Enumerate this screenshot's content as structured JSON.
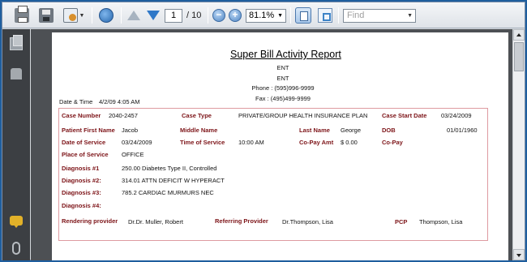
{
  "toolbar": {
    "page_current": "1",
    "page_total": "/ 10",
    "zoom": "81.1%",
    "find_placeholder": "Find",
    "icons": [
      "printer-icon",
      "save-icon",
      "export-icon",
      "globe-icon",
      "prev-page-icon",
      "next-page-icon",
      "zoom-out-icon",
      "zoom-in-icon",
      "fit-page-icon",
      "fit-width-icon"
    ]
  },
  "report": {
    "title": "Super Bill  Activity Report",
    "line1": "ENT",
    "line2": "ENT",
    "phone": "Phone : (595)996-9999",
    "fax": "Fax : (495)499-9999",
    "datetime_label": "Date & Time",
    "datetime_value": "4/2/09 4:05 AM",
    "fields": {
      "case_number_label": "Case Number",
      "case_number": "2040-2457",
      "case_type_label": "Case Type",
      "case_type": "PRIVATE/GROUP HEALTH INSURANCE PLAN",
      "case_start_label": "Case Start Date",
      "case_start": "03/24/2009",
      "first_name_label": "Patient First Name",
      "first_name": "Jacob",
      "middle_name_label": "Middle Name",
      "last_name_label": "Last Name",
      "last_name": "George",
      "dob_label": "DOB",
      "dob": "01/01/1960",
      "date_service_label": "Date of Service",
      "date_service": "03/24/2009",
      "time_service_label": "Time of Service",
      "time_service": "10:00 AM",
      "copay_amt_label": "Co-Pay Amt",
      "copay_amt": "$ 0.00",
      "copay_label": "Co-Pay",
      "place_label": "Place of Service",
      "place": "OFFICE",
      "diag1_label": "Diagnosis #1",
      "diag1": "250.00 Diabetes Type II, Controlled",
      "diag2_label": "Diagnosis #2:",
      "diag2": "314.01 ATTN DEFICIT W HYPERACT",
      "diag3_label": "Diagnosis #3:",
      "diag3": "785.2 CARDIAC MURMURS NEC",
      "diag4_label": "Diagnosis #4:",
      "rendering_label": "Rendering provider",
      "rendering": "Dr.Dr. Muller, Robert",
      "referring_label": "Referring Provider",
      "referring": "Dr.Thompson, Lisa",
      "pcp_label": "PCP",
      "pcp": "Thompson, Lisa"
    }
  },
  "colors": {
    "label": "#7d1418",
    "box_border": "#de9ba1",
    "outer_border": "#1f5e9e"
  }
}
